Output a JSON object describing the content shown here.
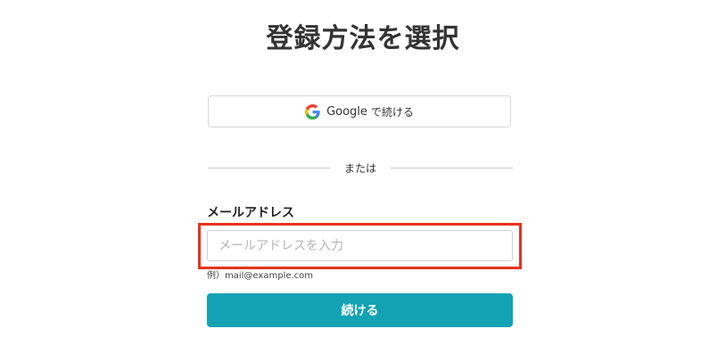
{
  "page": {
    "title": "登録方法を選択"
  },
  "google_button": {
    "label": "Google",
    "suffix": "で続ける",
    "icon": "google-g-icon"
  },
  "divider": {
    "text": "または"
  },
  "email_form": {
    "label": "メールアドレス",
    "placeholder": "メールアドレスを入力",
    "value": "",
    "hint": "例）mail@example.com"
  },
  "continue_button": {
    "label": "続ける"
  },
  "colors": {
    "primary": "#13a3b5",
    "highlight": "#e8331c",
    "text": "#333333"
  }
}
